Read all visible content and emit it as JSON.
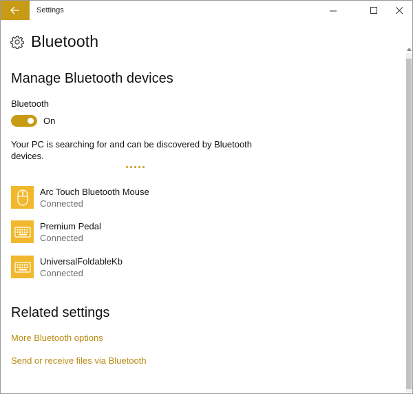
{
  "window": {
    "title": "Settings",
    "controls": {
      "minimize_icon": "minimize-icon",
      "maximize_icon": "maximize-icon",
      "close_icon": "close-icon"
    }
  },
  "header": {
    "icon": "gear-icon",
    "title": "Bluetooth"
  },
  "manage": {
    "section_title": "Manage Bluetooth devices",
    "bluetooth_label": "Bluetooth",
    "toggle_state": "On",
    "discover_text": "Your PC is searching for and can be discovered by Bluetooth devices."
  },
  "devices": [
    {
      "name": "Arc Touch Bluetooth Mouse",
      "status": "Connected",
      "icon": "mouse-icon"
    },
    {
      "name": "Premium Pedal",
      "status": "Connected",
      "icon": "keyboard-icon"
    },
    {
      "name": "UniversalFoldableKb",
      "status": "Connected",
      "icon": "keyboard-icon"
    }
  ],
  "related": {
    "section_title": "Related settings",
    "links": [
      "More Bluetooth options",
      "Send or receive files via Bluetooth"
    ]
  },
  "colors": {
    "accent": "#c79b16",
    "device_tile": "#f1b82d",
    "link": "#b88a10"
  }
}
